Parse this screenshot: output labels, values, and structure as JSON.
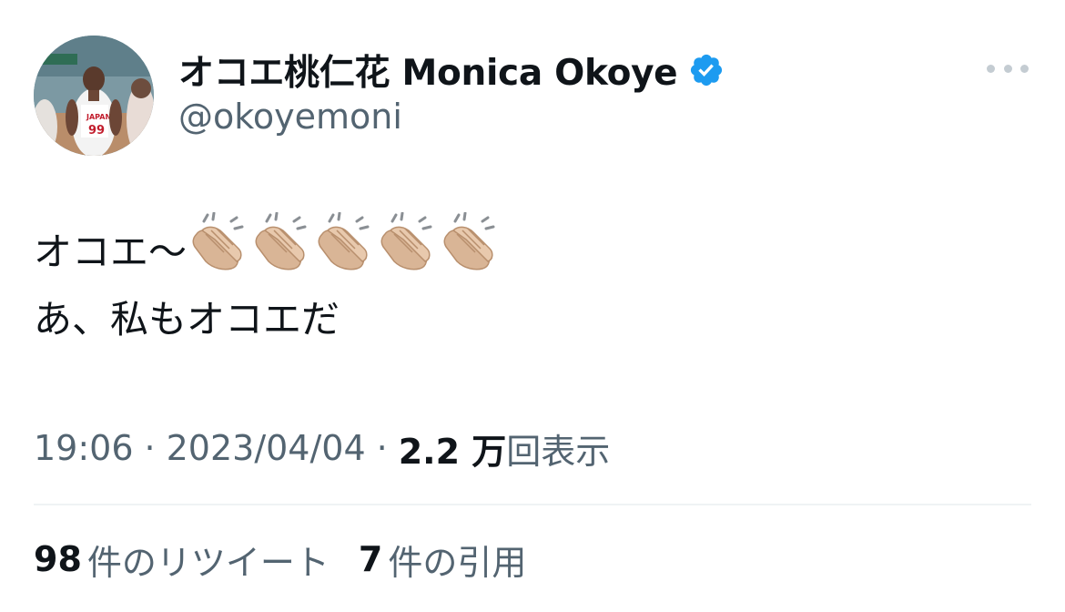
{
  "author": {
    "display_name": "オコエ桃仁花 Monica Okoye",
    "handle": "@okoyemoni",
    "verified": true,
    "avatar": "player-photo-avatar",
    "verified_color": "#1d9bf0"
  },
  "tweet": {
    "line1_text": "オコエ〜",
    "line1_emoji": "clapping-hands-icon",
    "line1_emoji_count": 5,
    "line2_text": "あ、私もオコエだ"
  },
  "meta": {
    "time": "19:06",
    "separator": "·",
    "date": "2023/04/04",
    "views_count": "2.2 万",
    "views_label": "回表示"
  },
  "stats": {
    "retweets_count": "98",
    "retweets_label": "件のリツイート",
    "quotes_count": "7",
    "quotes_label": "件の引用"
  },
  "menu": {
    "icon": "more-options-icon"
  }
}
